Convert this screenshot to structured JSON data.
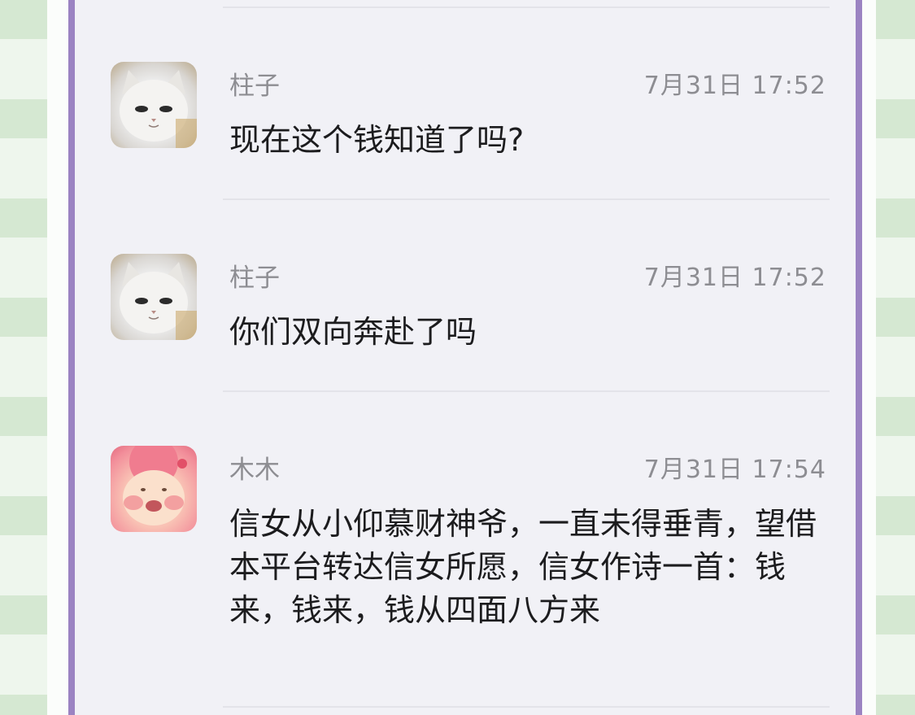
{
  "comments": [
    {
      "author": "柱子",
      "time": "7月31日 17:52",
      "text": "现在这个钱知道了吗?",
      "avatar_icon": "white-cat-avatar"
    },
    {
      "author": "柱子",
      "time": "7月31日 17:52",
      "text": "你们双向奔赴了吗",
      "avatar_icon": "white-cat-avatar"
    },
    {
      "author": "木木",
      "time": "7月31日 17:54",
      "text": "信女从小仰慕财神爷，一直未得垂青，望借本平台转达信女所愿，信女作诗一首：钱来，钱来，钱从四面八方来",
      "avatar_icon": "pink-bun-face-avatar"
    }
  ],
  "colors": {
    "panel_border": "#9b83c2",
    "panel_bg": "#f1f1f6",
    "meta_text": "#8d8d92",
    "body_text": "#1c1c1e"
  }
}
